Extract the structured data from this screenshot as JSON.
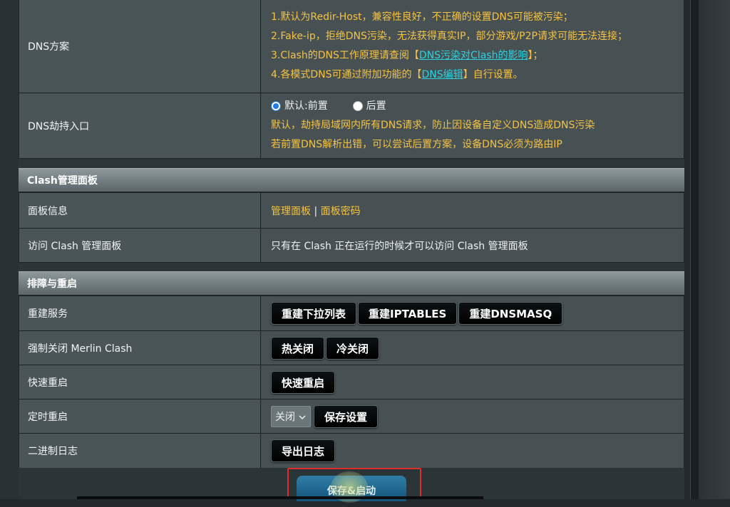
{
  "dns_scheme": {
    "label": "DNS方案",
    "note1": "1.默认为Redir-Host，兼容性良好，不正确的设置DNS可能被污染；",
    "note2": "2.Fake-ip，拒绝DNS污染，无法获得真实IP，部分游戏/P2P请求可能无法连接；",
    "note3_pre": "3.Clash的DNS工作原理请查阅【",
    "note3_link": "DNS污染对Clash的影响",
    "note3_post": "】；",
    "note4_pre": "4.各模式DNS可通过附加功能的【",
    "note4_link": "DNS编辑",
    "note4_post": "】自行设置。"
  },
  "dns_hijack": {
    "label": "DNS劫持入口",
    "option_default": "默认:前置",
    "option_post": "后置",
    "selected": "默认:前置",
    "desc1": "默认，劫持局域网内所有DNS请求，防止因设备自定义DNS造成DNS污染",
    "desc2": "若前置DNS解析出错，可以尝试后置方案，设备DNS必须为路由IP"
  },
  "clash_panel": {
    "header": "Clash管理面板",
    "panel_info_label": "面板信息",
    "panel_link": "管理面板",
    "separator": "|",
    "password_link": "面板密码",
    "access_label": "访问 Clash 管理面板",
    "access_desc": "只有在 Clash 正在运行的时候才可以访问 Clash 管理面板"
  },
  "troubleshoot": {
    "header": "排障与重启",
    "rebuild_label": "重建服务",
    "btn_rebuild_dropdown": "重建下拉列表",
    "btn_rebuild_iptables": "重建IPTABLES",
    "btn_rebuild_dnsmasq": "重建DNSMASQ",
    "force_close_label": "强制关闭 Merlin Clash",
    "btn_hot_close": "热关闭",
    "btn_cold_close": "冷关闭",
    "fast_restart_label": "快速重启",
    "btn_fast_restart": "快速重启",
    "timed_restart_label": "定时重启",
    "timed_restart_value": "关闭",
    "btn_save_settings": "保存设置",
    "binary_log_label": "二进制日志",
    "btn_export_log": "导出日志"
  },
  "footer": {
    "save_start": "保存&启动"
  },
  "colors": {
    "accent_yellow": "#f5c242",
    "link_cyan": "#2bd3e0",
    "highlight_red": "#e02b2b",
    "radio_blue": "#1e7be8"
  },
  "icons": {
    "dropdown": "chevron-down-icon"
  }
}
